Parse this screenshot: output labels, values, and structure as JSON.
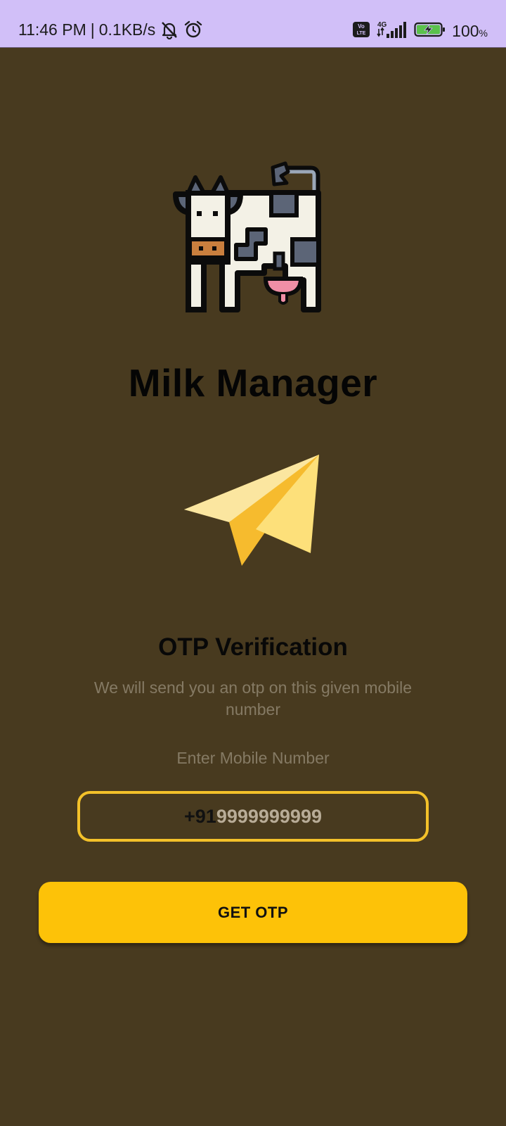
{
  "status_bar": {
    "time": "11:46 PM",
    "separator": "|",
    "network_speed": "0.1KB/s",
    "network_type": "4G",
    "volte_label": "Vo LTE",
    "battery_percent": "100",
    "battery_unit": "%",
    "icons": [
      "notifications-off-icon",
      "alarm-icon",
      "volte-icon",
      "signal-icon",
      "battery-charging-icon"
    ],
    "background_color": "#d1bff8"
  },
  "app": {
    "title": "Milk Manager",
    "logo": "cow-icon",
    "background_color": "#483a1f"
  },
  "otp": {
    "illustration": "paper-plane-icon",
    "heading": "OTP Verification",
    "description": "We will send you an otp on this given mobile number",
    "mobile_label": "Enter Mobile Number",
    "country_code": "+91",
    "mobile_number": "9999999999",
    "button_label": "GET OTP",
    "accent_color": "#fdc208"
  }
}
